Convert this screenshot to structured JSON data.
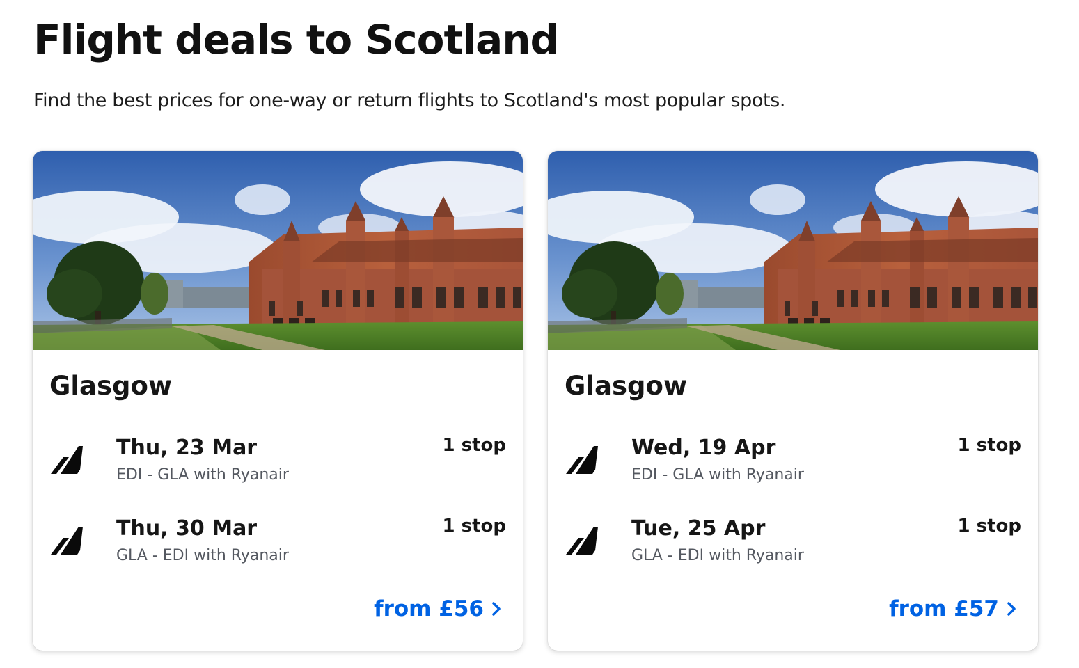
{
  "header": {
    "title": "Flight deals to Scotland",
    "subtitle": "Find the best prices for one-way or return flights to Scotland's most popular spots."
  },
  "colors": {
    "link": "#0062e3",
    "secondary_text": "#545860",
    "primary_text": "#161616"
  },
  "cards": [
    {
      "image_icon": "photo-kelvingrove-building",
      "city": "Glasgow",
      "legs": [
        {
          "icon": "ryanair-logo-icon",
          "date": "Thu, 23 Mar",
          "route": "EDI - GLA with Ryanair",
          "stops": "1 stop"
        },
        {
          "icon": "ryanair-logo-icon",
          "date": "Thu, 30 Mar",
          "route": "GLA - EDI with Ryanair",
          "stops": "1 stop"
        }
      ],
      "price": "from £56"
    },
    {
      "image_icon": "photo-kelvingrove-building",
      "city": "Glasgow",
      "legs": [
        {
          "icon": "ryanair-logo-icon",
          "date": "Wed, 19 Apr",
          "route": "EDI - GLA with Ryanair",
          "stops": "1 stop"
        },
        {
          "icon": "ryanair-logo-icon",
          "date": "Tue, 25 Apr",
          "route": "GLA - EDI with Ryanair",
          "stops": "1 stop"
        }
      ],
      "price": "from £57"
    }
  ]
}
